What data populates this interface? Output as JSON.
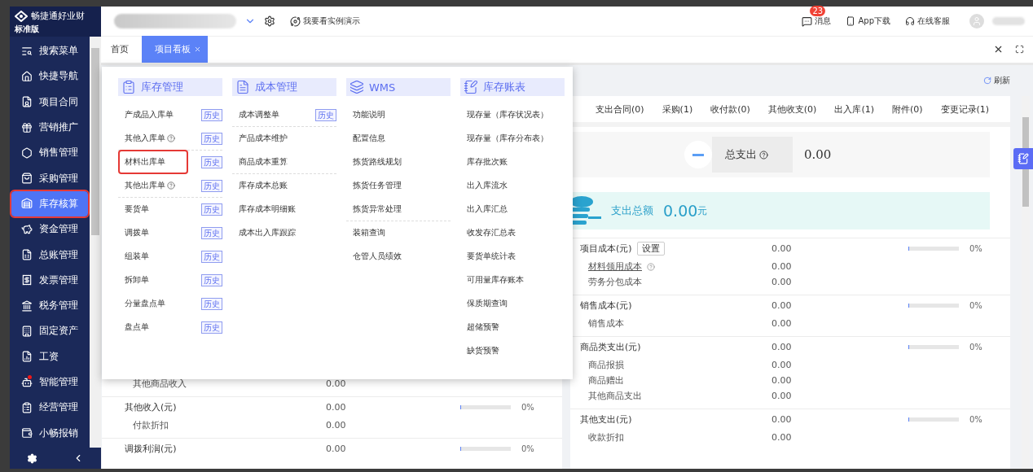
{
  "brand": {
    "name": "畅捷通好业财",
    "edition": "标准版"
  },
  "sidebar": {
    "items": [
      {
        "label": "搜索菜单",
        "selected": false,
        "highlighted": false,
        "dot": false
      },
      {
        "label": "快捷导航",
        "selected": false,
        "highlighted": false,
        "dot": false
      },
      {
        "label": "项目合同",
        "selected": false,
        "highlighted": false,
        "dot": false
      },
      {
        "label": "营销推广",
        "selected": false,
        "highlighted": false,
        "dot": false
      },
      {
        "label": "销售管理",
        "selected": false,
        "highlighted": false,
        "dot": false
      },
      {
        "label": "采购管理",
        "selected": false,
        "highlighted": false,
        "dot": false
      },
      {
        "label": "库存核算",
        "selected": true,
        "highlighted": true,
        "dot": false
      },
      {
        "label": "资金管理",
        "selected": false,
        "highlighted": false,
        "dot": false
      },
      {
        "label": "总账管理",
        "selected": false,
        "highlighted": false,
        "dot": false
      },
      {
        "label": "发票管理",
        "selected": false,
        "highlighted": false,
        "dot": false
      },
      {
        "label": "税务管理",
        "selected": false,
        "highlighted": false,
        "dot": false
      },
      {
        "label": "固定资产",
        "selected": false,
        "highlighted": false,
        "dot": false
      },
      {
        "label": "工资",
        "selected": false,
        "highlighted": false,
        "dot": false
      },
      {
        "label": "智能管理",
        "selected": false,
        "highlighted": false,
        "dot": true
      },
      {
        "label": "经营管理",
        "selected": false,
        "highlighted": false,
        "dot": false
      },
      {
        "label": "小畅报销",
        "selected": false,
        "highlighted": false,
        "dot": false
      }
    ]
  },
  "topbar": {
    "demo": "我要看实例演示",
    "messages": {
      "label": "消息",
      "badge": "23"
    },
    "app": "App下载",
    "service": "在线客服"
  },
  "tabs": [
    {
      "label": "首页",
      "selected": false,
      "closable": false
    },
    {
      "label": "项目看板",
      "selected": true,
      "closable": true
    }
  ],
  "refresh": "刷新",
  "menu": {
    "columns": [
      {
        "title": "库存管理",
        "items": [
          {
            "label": "产成品入库单",
            "history": "历史",
            "help": false,
            "highlighted": false,
            "separated": false
          },
          {
            "label": "其他入库单",
            "history": "历史",
            "help": true,
            "highlighted": false,
            "separated": true
          },
          {
            "label": "材料出库单",
            "history": "历史",
            "help": false,
            "highlighted": true,
            "separated": false
          },
          {
            "label": "其他出库单",
            "history": "历史",
            "help": true,
            "highlighted": false,
            "separated": true
          },
          {
            "label": "要货单",
            "history": "历史",
            "help": false,
            "highlighted": false,
            "separated": false
          },
          {
            "label": "调拨单",
            "history": "历史",
            "help": false,
            "highlighted": false,
            "separated": false
          },
          {
            "label": "组装单",
            "history": "历史",
            "help": false,
            "highlighted": false,
            "separated": false
          },
          {
            "label": "拆卸单",
            "history": "历史",
            "help": false,
            "highlighted": false,
            "separated": false
          },
          {
            "label": "分量盘点单",
            "history": "历史",
            "help": false,
            "highlighted": false,
            "separated": false
          },
          {
            "label": "盘点单",
            "history": "历史",
            "help": false,
            "highlighted": false,
            "separated": false
          }
        ]
      },
      {
        "title": "成本管理",
        "items": [
          {
            "label": "成本调整单",
            "history": "历史",
            "help": false,
            "highlighted": false,
            "separated": true
          },
          {
            "label": "产品成本维护",
            "help": false,
            "highlighted": false,
            "separated": false
          },
          {
            "label": "商品成本重算",
            "help": false,
            "highlighted": false,
            "separated": true
          },
          {
            "label": "库存成本总账",
            "help": false,
            "highlighted": false,
            "separated": false
          },
          {
            "label": "库存成本明细账",
            "help": false,
            "highlighted": false,
            "separated": false
          },
          {
            "label": "成本出入库跟踪",
            "help": false,
            "highlighted": false,
            "separated": false
          }
        ]
      },
      {
        "title": "WMS",
        "items": [
          {
            "label": "功能说明",
            "help": false,
            "highlighted": false,
            "separated": false
          },
          {
            "label": "配置信息",
            "help": false,
            "highlighted": false,
            "separated": false
          },
          {
            "label": "拣货路线规划",
            "help": false,
            "highlighted": false,
            "separated": false
          },
          {
            "label": "拣货任务管理",
            "help": false,
            "highlighted": false,
            "separated": false
          },
          {
            "label": "拣货异常处理",
            "help": false,
            "highlighted": false,
            "separated": true
          },
          {
            "label": "装箱查询",
            "help": false,
            "highlighted": false,
            "separated": false
          },
          {
            "label": "仓管人员绩效",
            "help": false,
            "highlighted": false,
            "separated": false
          }
        ]
      },
      {
        "title": "库存账表",
        "items": [
          {
            "label": "现存量（库存状况表）",
            "help": false,
            "highlighted": false,
            "separated": false
          },
          {
            "label": "现存量（库存分布表）",
            "help": false,
            "highlighted": false,
            "separated": false
          },
          {
            "label": "库存批次账",
            "help": false,
            "highlighted": false,
            "separated": false
          },
          {
            "label": "出入库流水",
            "help": false,
            "highlighted": false,
            "separated": false
          },
          {
            "label": "出入库汇总",
            "help": false,
            "highlighted": false,
            "separated": false
          },
          {
            "label": "收发存汇总表",
            "help": false,
            "highlighted": false,
            "separated": false
          },
          {
            "label": "要货单统计表",
            "help": false,
            "highlighted": false,
            "separated": false
          },
          {
            "label": "可用量库存账本",
            "help": false,
            "highlighted": false,
            "separated": false
          },
          {
            "label": "保质期查询",
            "help": false,
            "highlighted": false,
            "separated": false
          },
          {
            "label": "超储预警",
            "help": false,
            "highlighted": false,
            "separated": false
          },
          {
            "label": "缺货预警",
            "help": false,
            "highlighted": false,
            "separated": false
          }
        ]
      }
    ]
  },
  "income": {
    "rows": [
      {
        "kind": "child",
        "label": "其他商品收入",
        "value": "0.00"
      },
      {
        "kind": "group",
        "label": "其他收入(元)",
        "value": "0.00",
        "level": 0,
        "percent": "0%"
      },
      {
        "kind": "child",
        "label": "付款折扣",
        "value": "0.00"
      },
      {
        "kind": "group",
        "label": "调拨利润(元)",
        "value": "0.00",
        "level": 0,
        "percent": "0%"
      }
    ]
  },
  "expense": {
    "tabs": [
      "支出合同(0)",
      "采购(1)",
      "收付款(0)",
      "其他收支(0)",
      "出入库(1)",
      "附件(0)",
      "变更记录(1)"
    ],
    "total": {
      "label": "总支出",
      "value": "0.00"
    },
    "banner": {
      "label": "支出总额",
      "value": "0.00",
      "unit": "元"
    },
    "rows": [
      {
        "kind": "group",
        "label": "项目成本(元)",
        "button": "设置",
        "value": "0.00",
        "level": 0,
        "percent": "0%"
      },
      {
        "kind": "link",
        "label": "材料领用成本",
        "value": "0.00"
      },
      {
        "kind": "child",
        "label": "劳务分包成本",
        "value": "0.00"
      },
      {
        "kind": "group",
        "label": "销售成本(元)",
        "value": "0.00",
        "level": 0,
        "percent": "0%"
      },
      {
        "kind": "child",
        "label": "销售成本",
        "value": "0.00"
      },
      {
        "kind": "group",
        "label": "商品类支出(元)",
        "value": "0.00",
        "level": 0,
        "percent": "0%"
      },
      {
        "kind": "child",
        "label": "商品报损",
        "value": "0.00"
      },
      {
        "kind": "child",
        "label": "商品赠出",
        "value": "0.00"
      },
      {
        "kind": "child",
        "label": "其他商品支出",
        "value": "0.00"
      },
      {
        "kind": "group",
        "label": "其他支出(元)",
        "value": "0.00",
        "level": 0,
        "percent": "0%"
      },
      {
        "kind": "child",
        "label": "收款折扣",
        "value": "0.00"
      }
    ]
  }
}
